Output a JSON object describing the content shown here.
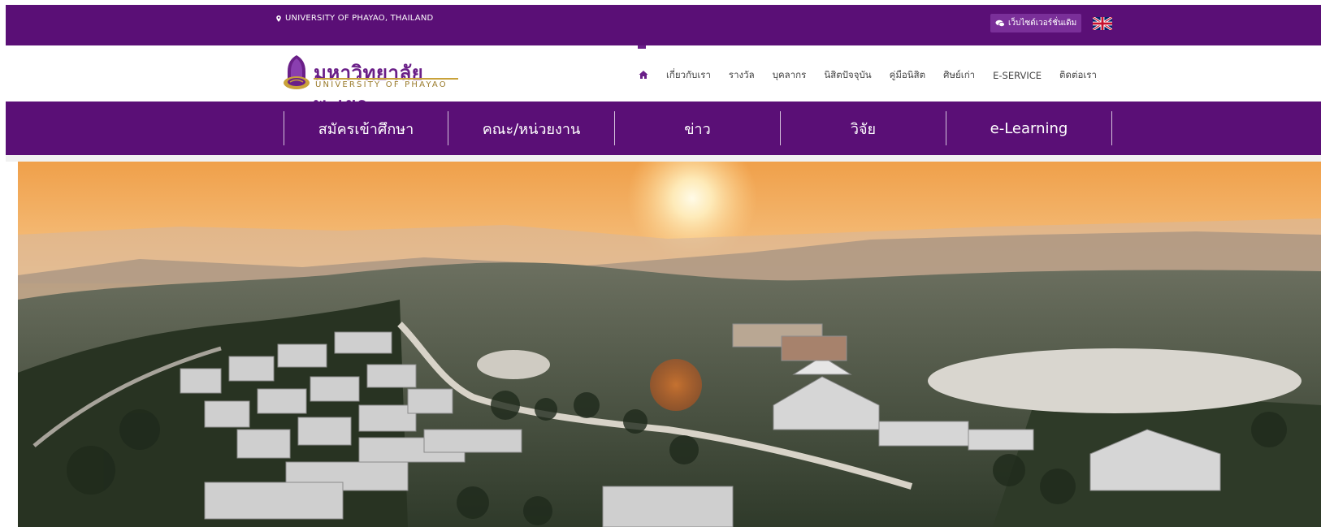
{
  "topbar": {
    "location": "UNIVERSITY OF PHAYAO, THAILAND",
    "old_site_label": "เว็บไซต์เวอร์ชั่นเดิม",
    "language_flag": "uk-flag-icon"
  },
  "logo": {
    "thai": "มหาวิทยาลัยพะเยา",
    "english": "UNIVERSITY OF PHAYAO"
  },
  "nav": {
    "items": [
      "เกี่ยวกับเรา",
      "รางวัล",
      "บุคลากร",
      "นิสิตปัจจุบัน",
      "คู่มือนิสิต",
      "ศิษย์เก่า",
      "E-SERVICE",
      "ติดต่อเรา"
    ]
  },
  "main_nav": {
    "items": [
      "สมัครเข้าศึกษา",
      "คณะ/หน่วยงาน",
      "ข่าว",
      "วิจัย",
      "e-Learning"
    ]
  },
  "colors": {
    "brand_purple": "#5a0f76",
    "gold": "#c9a23a"
  }
}
